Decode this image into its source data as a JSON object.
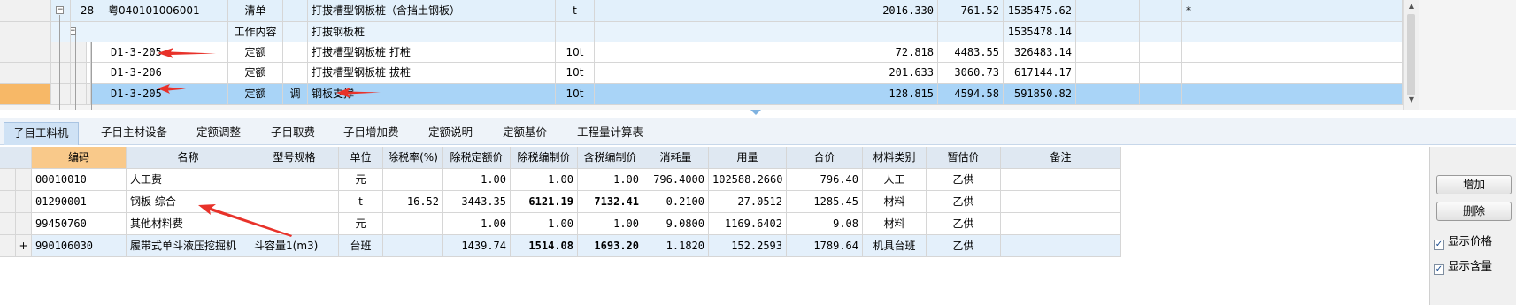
{
  "top_grid": {
    "rows": [
      {
        "seq": "28",
        "code": "粤040101006001",
        "type": "清单",
        "flag": "",
        "name": "打拔槽型钢板桩（含挡土钢板）",
        "unit": "t",
        "qty": "2016.330",
        "price": "761.52",
        "total": "1535475.62",
        "star": "*"
      },
      {
        "seq": "",
        "code": "",
        "type": "工作内容",
        "flag": "",
        "name": "打拔钢板桩",
        "unit": "",
        "qty": "",
        "price": "",
        "total": "1535478.14",
        "star": ""
      },
      {
        "seq": "",
        "code": "D1-3-205",
        "type": "定额",
        "flag": "",
        "name": "打拔槽型钢板桩 打桩",
        "unit": "10t",
        "qty": "72.818",
        "price": "4483.55",
        "total": "326483.14",
        "star": ""
      },
      {
        "seq": "",
        "code": "D1-3-206",
        "type": "定额",
        "flag": "",
        "name": "打拔槽型钢板桩 拔桩",
        "unit": "10t",
        "qty": "201.633",
        "price": "3060.73",
        "total": "617144.17",
        "star": ""
      },
      {
        "seq": "",
        "code": "D1-3-205",
        "type": "定额",
        "flag": "调",
        "name": "钢板支撑",
        "unit": "10t",
        "qty": "128.815",
        "price": "4594.58",
        "total": "591850.82",
        "star": ""
      }
    ],
    "expander_minus": "−"
  },
  "tabs": [
    "子目工料机",
    "子目主材设备",
    "定额调整",
    "子目取费",
    "子目增加费",
    "定额说明",
    "定额基价",
    "工程量计算表"
  ],
  "sub_grid": {
    "headers": [
      "编码",
      "名称",
      "型号规格",
      "单位",
      "除税率(%)",
      "除税定额价",
      "除税编制价",
      "含税编制价",
      "消耗量",
      "用量",
      "合价",
      "材料类别",
      "暂估价",
      "备注"
    ],
    "rows": [
      {
        "code": "00010010",
        "name": "人工费",
        "spec": "",
        "unit": "元",
        "rate": "",
        "base": "1.00",
        "price_ex": "1.00",
        "price_in": "1.00",
        "consume": "796.4000",
        "usage": "102588.2660",
        "total": "796.40",
        "category": "人工",
        "estimate": "乙供",
        "note": "",
        "expand": ""
      },
      {
        "code": "01290001",
        "name": "钢板 综合",
        "spec": "",
        "unit": "t",
        "rate": "16.52",
        "base": "3443.35",
        "price_ex": "6121.19",
        "price_in": "7132.41",
        "consume": "0.2100",
        "usage": "27.0512",
        "total": "1285.45",
        "category": "材料",
        "estimate": "乙供",
        "note": "",
        "expand": ""
      },
      {
        "code": "99450760",
        "name": "其他材料费",
        "spec": "",
        "unit": "元",
        "rate": "",
        "base": "1.00",
        "price_ex": "1.00",
        "price_in": "1.00",
        "consume": "9.0800",
        "usage": "1169.6402",
        "total": "9.08",
        "category": "材料",
        "estimate": "乙供",
        "note": "",
        "expand": ""
      },
      {
        "code": "990106030",
        "name": "履带式单斗液压挖掘机",
        "spec": "斗容量1(m3)",
        "unit": "台班",
        "rate": "",
        "base": "1439.74",
        "price_ex": "1514.08",
        "price_in": "1693.20",
        "consume": "1.1820",
        "usage": "152.2593",
        "total": "1789.64",
        "category": "机具台班",
        "estimate": "乙供",
        "note": "",
        "expand": "+"
      }
    ]
  },
  "side_panel": {
    "add_label": "增加",
    "delete_label": "删除",
    "show_price_label": "显示价格",
    "show_content_label": "显示含量",
    "check_mark": "✓"
  },
  "colors": {
    "selected_row": "#a9d4f7",
    "highlight_header": "#f9c98a",
    "arrow": "#e8322a"
  }
}
